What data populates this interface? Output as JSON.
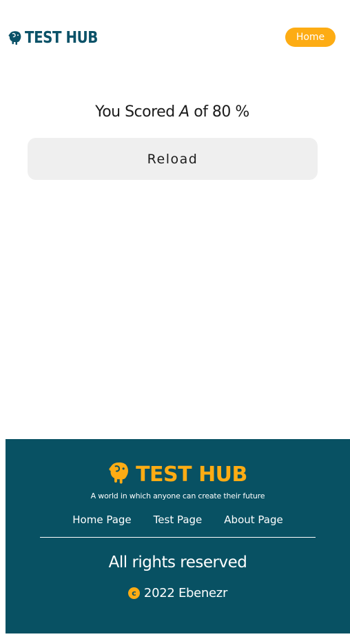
{
  "header": {
    "brand": "TEST HUB",
    "home_label": "Home"
  },
  "main": {
    "score_prefix": "You Scored",
    "score_grade": "A",
    "score_suffix": "of 80 %",
    "reload_label": "Reload"
  },
  "footer": {
    "brand": "TEST HUB",
    "tagline": "A world in which anyone can create their future",
    "links": [
      "Home Page",
      "Test Page",
      "About Page"
    ],
    "rights": "All rights reserved",
    "copyright_symbol": "c",
    "copyright_text": "2022 Ebenezr"
  },
  "colors": {
    "brand_teal": "#0b5268",
    "accent_orange": "#fdac14",
    "footer_bg": "#085163",
    "reload_bg": "#efefef"
  },
  "icons": {
    "brand_logo": "elephant-icon",
    "footer_logo": "elephant-icon",
    "copyright": "copyright-icon"
  }
}
